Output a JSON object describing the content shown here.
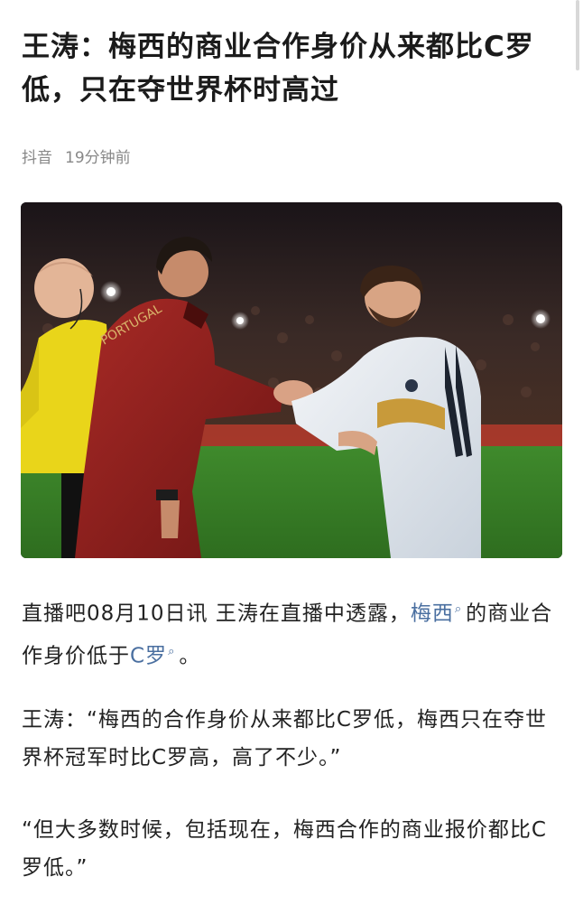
{
  "article": {
    "title": "王涛：梅西的商业合作身价从来都比C罗低，只在夺世界杯时高过",
    "source": "抖音",
    "time": "19分钟前"
  },
  "paragraphs": {
    "p1_prefix": "直播吧08月10日讯  王涛在直播中透露，",
    "p1_link1": "梅西",
    "p1_mid": "的商业合作身价低于",
    "p1_link2": "C罗",
    "p1_suffix": "。",
    "p2": "王涛：“梅西的合作身价从来都比C罗低，梅西只在夺世界杯冠军时比C罗高，高了不少。”",
    "p3": "“但大多数时候，包括现在，梅西合作的商业报价都比C罗低。”"
  },
  "icons": {
    "search_mark": "search-mark-icon"
  },
  "colors": {
    "link": "#4a6fa0",
    "meta": "#888888",
    "title": "#1b1b1b"
  }
}
